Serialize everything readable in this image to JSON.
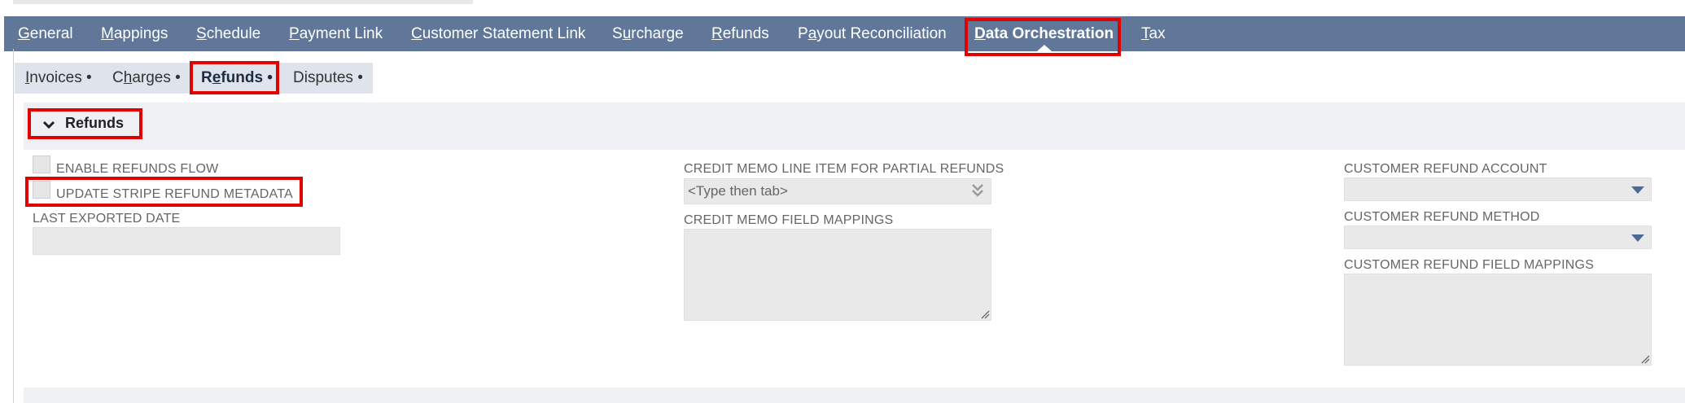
{
  "main_tabs": [
    {
      "pre": "",
      "u": "G",
      "post": "eneral"
    },
    {
      "pre": "",
      "u": "M",
      "post": "appings"
    },
    {
      "pre": "",
      "u": "S",
      "post": "chedule"
    },
    {
      "pre": "",
      "u": "P",
      "post": "ayment Link"
    },
    {
      "pre": "",
      "u": "C",
      "post": "ustomer Statement Link"
    },
    {
      "pre": "S",
      "u": "u",
      "post": "rcharge"
    },
    {
      "pre": "",
      "u": "R",
      "post": "efunds"
    },
    {
      "pre": "P",
      "u": "a",
      "post": "yout Reconciliation"
    },
    {
      "pre": "",
      "u": "D",
      "post": "ata Orchestration"
    },
    {
      "pre": "",
      "u": "T",
      "post": "ax"
    }
  ],
  "sub_tabs": [
    {
      "pre": "",
      "u": "I",
      "post": "nvoices •"
    },
    {
      "pre": "C",
      "u": "h",
      "post": "arges •"
    },
    {
      "pre": "R",
      "u": "e",
      "post": "funds •"
    },
    {
      "pre": "",
      "u": "",
      "post": "Disputes •"
    }
  ],
  "section": {
    "title": "Refunds"
  },
  "left": {
    "enable_refunds_label": "ENABLE REFUNDS FLOW",
    "update_stripe_label": "UPDATE STRIPE REFUND METADATA",
    "last_exported_label": "LAST EXPORTED DATE",
    "last_exported_value": ""
  },
  "middle": {
    "credit_memo_line_label": "CREDIT MEMO LINE ITEM FOR PARTIAL REFUNDS",
    "credit_memo_line_placeholder": "<Type then tab>",
    "credit_memo_mappings_label": "CREDIT MEMO FIELD MAPPINGS",
    "credit_memo_mappings_value": ""
  },
  "right": {
    "refund_account_label": "CUSTOMER REFUND ACCOUNT",
    "refund_account_value": "",
    "refund_method_label": "CUSTOMER REFUND METHOD",
    "refund_method_value": "",
    "refund_mappings_label": "CUSTOMER REFUND FIELD MAPPINGS",
    "refund_mappings_value": ""
  },
  "icons": {
    "section_toggle": "chevron-down-icon",
    "dropdown": "caret-down-icon",
    "autocomplete": "double-chevron-down-icon",
    "resize": "resize-grip-icon"
  },
  "colors": {
    "main_tab_bar": "#607799",
    "sub_tab_bar": "#dfe3eb",
    "highlight": "#e00000",
    "dropdown_arrow": "#4d6a95"
  }
}
